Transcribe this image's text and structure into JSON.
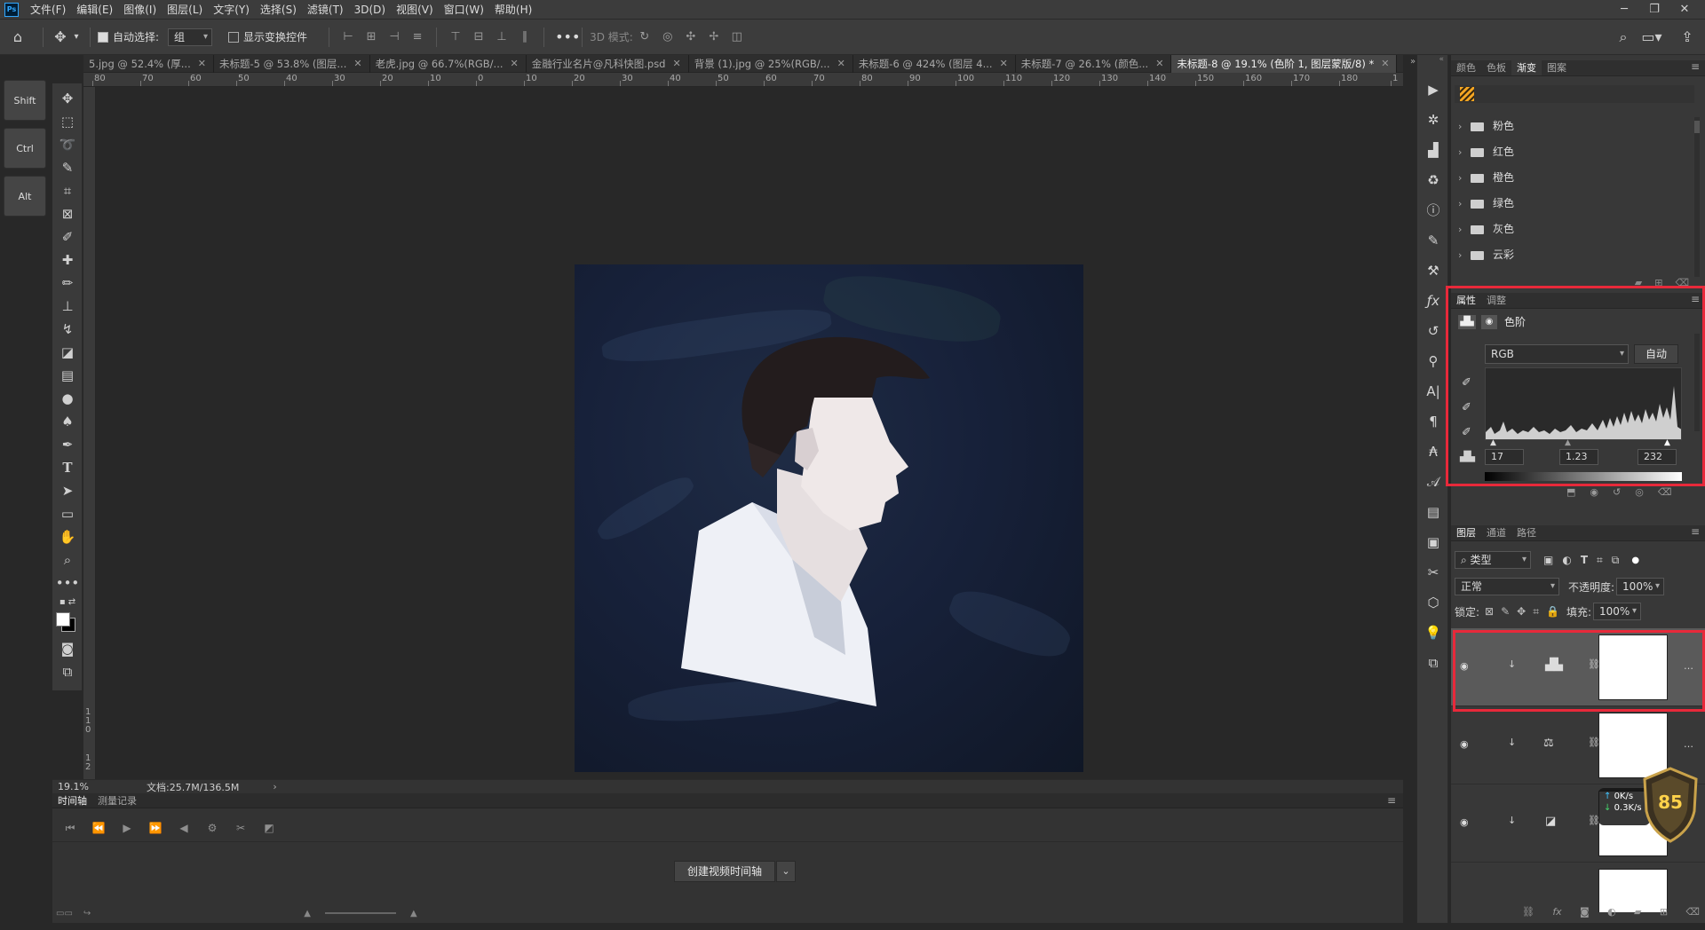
{
  "menubar": {
    "logo": "Ps",
    "items": [
      "文件(F)",
      "编辑(E)",
      "图像(I)",
      "图层(L)",
      "文字(Y)",
      "选择(S)",
      "滤镜(T)",
      "3D(D)",
      "视图(V)",
      "窗口(W)",
      "帮助(H)"
    ]
  },
  "options": {
    "auto_select_label": "自动选择:",
    "auto_select_value": "组",
    "show_transform_label": "显示变换控件",
    "mode_3d_label": "3D 模式:"
  },
  "shortcut_keys": [
    "Shift",
    "Ctrl",
    "Alt"
  ],
  "tabs": [
    {
      "label": "5.jpg @ 52.4% (厚...",
      "active": false
    },
    {
      "label": "未标题-5 @ 53.8% (图层...",
      "active": false
    },
    {
      "label": "老虎.jpg @ 66.7%(RGB/...",
      "active": false
    },
    {
      "label": "金融行业名片@凡科快图.psd",
      "active": false
    },
    {
      "label": "背景 (1).jpg @ 25%(RGB/...",
      "active": false
    },
    {
      "label": "未标题-6 @ 424% (图层 4...",
      "active": false
    },
    {
      "label": "未标题-7 @ 26.1% (颜色...",
      "active": false
    },
    {
      "label": "未标题-8 @ 19.1% (色阶 1, 图层蒙版/8) *",
      "active": true
    }
  ],
  "ruler_h": [
    "80",
    "70",
    "60",
    "50",
    "40",
    "30",
    "20",
    "10",
    "0",
    "10",
    "20",
    "30",
    "40",
    "50",
    "60",
    "70",
    "80",
    "90",
    "100",
    "110",
    "120",
    "130",
    "140",
    "150",
    "160",
    "170",
    "180",
    "1"
  ],
  "ruler_v": [
    "1",
    "1",
    "0",
    "1",
    "2"
  ],
  "status": {
    "zoom": "19.1%",
    "doc": "文档:25.7M/136.5M"
  },
  "timeline": {
    "tabs": [
      "时间轴",
      "测量记录"
    ],
    "create_btn": "创建视频时间轴"
  },
  "swatches_panel": {
    "tabs": [
      "颜色",
      "色板",
      "渐变",
      "图案"
    ],
    "folders": [
      "粉色",
      "红色",
      "橙色",
      "绿色",
      "灰色",
      "云彩"
    ]
  },
  "properties": {
    "tabs": [
      "属性",
      "调整"
    ],
    "title": "色阶",
    "channel": "RGB",
    "auto_btn": "自动",
    "input_black": "17",
    "input_gamma": "1.23",
    "input_white": "232"
  },
  "layers": {
    "tabs": [
      "图层",
      "通道",
      "路径"
    ],
    "filter_label": "类型",
    "blend_mode": "正常",
    "opacity_label": "不透明度:",
    "opacity": "100%",
    "lock_label": "锁定:",
    "fill_label": "填充:",
    "fill": "100%"
  },
  "net": {
    "up": "0K/s",
    "down": "0.3K/s",
    "score": "85"
  },
  "colors": {
    "accent_red": "#e8293a",
    "panel": "#383838",
    "artboard": "#17213a"
  }
}
